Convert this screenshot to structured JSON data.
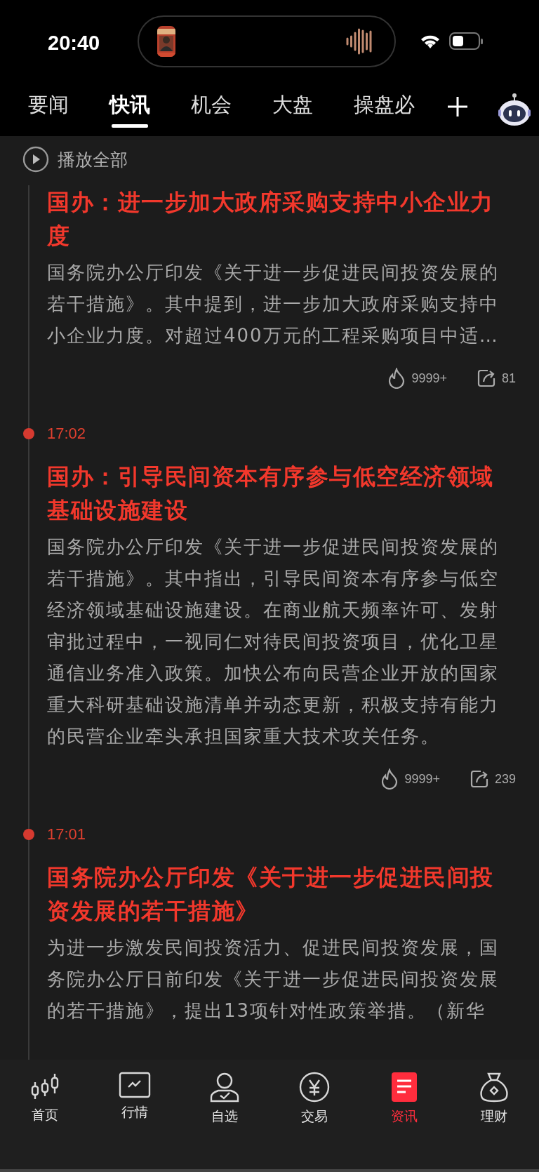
{
  "status_bar": {
    "time": "20:40"
  },
  "tabs": [
    {
      "label": "要闻",
      "selected": false
    },
    {
      "label": "快讯",
      "selected": true
    },
    {
      "label": "机会",
      "selected": false
    },
    {
      "label": "大盘",
      "selected": false
    },
    {
      "label": "操盘必",
      "selected": false
    }
  ],
  "play_all": {
    "label": "播放全部"
  },
  "news": [
    {
      "title": "国办：进一步加大政府采购支持中小企业力度",
      "body": "国务院办公厅印发《关于进一步促进民间投资发展的若干措施》。其中提到，进一步加大政府采购支持中小企业力度。对超过400万元的工程采购项目中适…",
      "heat": "9999+",
      "shares": "81"
    },
    {
      "time": "17:02",
      "title": "国办：引导民间资本有序参与低空经济领域基础设施建设",
      "body": "国务院办公厅印发《关于进一步促进民间投资发展的若干措施》。其中指出，引导民间资本有序参与低空经济领域基础设施建设。在商业航天频率许可、发射审批过程中，一视同仁对待民间投资项目，优化卫星通信业务准入政策。加快公布向民营企业开放的国家重大科研基础设施清单并动态更新，积极支持有能力的民营企业牵头承担国家重大技术攻关任务。",
      "heat": "9999+",
      "shares": "239"
    },
    {
      "time": "17:01",
      "title": "国务院办公厅印发《关于进一步促进民间投资发展的若干措施》",
      "body": "为进一步激发民间投资活力、促进民间投资发展，国务院办公厅日前印发《关于进一步促进民间投资发展的若干措施》，提出13项针对性政策举措。（新华"
    }
  ],
  "bottom_nav": [
    {
      "kind": "candles",
      "label": "首页",
      "selected": false
    },
    {
      "kind": "chart",
      "label": "行情",
      "selected": false
    },
    {
      "kind": "person",
      "label": "自选",
      "selected": false
    },
    {
      "kind": "yen",
      "label": "交易",
      "selected": false
    },
    {
      "kind": "doc",
      "label": "资讯",
      "selected": true
    },
    {
      "kind": "bag",
      "label": "理财",
      "selected": false
    }
  ]
}
